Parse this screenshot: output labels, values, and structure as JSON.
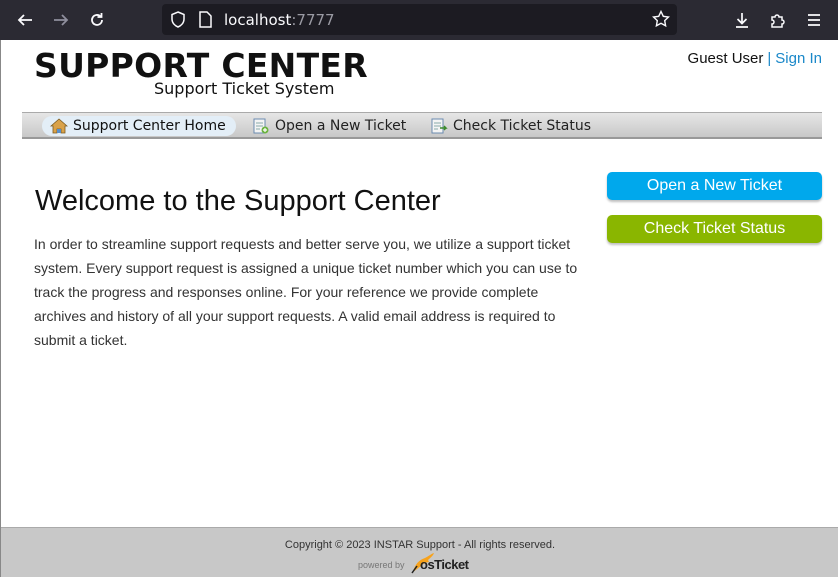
{
  "browser": {
    "url_host": "localhost",
    "url_port": ":7777"
  },
  "header": {
    "title": "SUPPORT CENTER",
    "subtitle": "Support Ticket System",
    "user_label": "Guest User",
    "separator": "|",
    "sign_in": "Sign In"
  },
  "nav": {
    "items": [
      {
        "label": "Support Center Home"
      },
      {
        "label": "Open a New Ticket"
      },
      {
        "label": "Check Ticket Status"
      }
    ]
  },
  "main": {
    "heading": "Welcome to the Support Center",
    "intro": "In order to streamline support requests and better serve you, we utilize a support ticket system. Every support request is assigned a unique ticket number which you can use to track the progress and responses online. For your reference we provide complete archives and history of all your support requests. A valid email address is required to submit a ticket.",
    "open_ticket_button": "Open a New Ticket",
    "check_status_button": "Check Ticket Status"
  },
  "footer": {
    "copyright": "Copyright © 2023 INSTAR Support - All rights reserved.",
    "powered_by": "powered by",
    "brand": "osTicket"
  },
  "colors": {
    "blue_button": "#00a8ec",
    "green_button": "#8ab600",
    "link": "#1a88c9"
  }
}
